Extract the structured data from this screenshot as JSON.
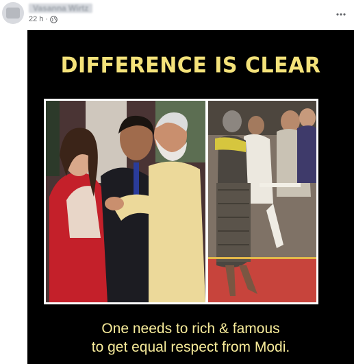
{
  "post": {
    "author_name": "Vasanna Wirtz",
    "timestamp": "22 h",
    "separator": "·",
    "privacy_icon": "globe-icon",
    "more_icon": "more-options-icon"
  },
  "image": {
    "headline": "DIFFERENCE IS CLEAR",
    "caption_line1": "One needs to rich & famous",
    "caption_line2": "to get equal respect from Modi.",
    "colors": {
      "background": "#000000",
      "headline": "#f4e27a",
      "caption": "#f7eb9a"
    }
  }
}
